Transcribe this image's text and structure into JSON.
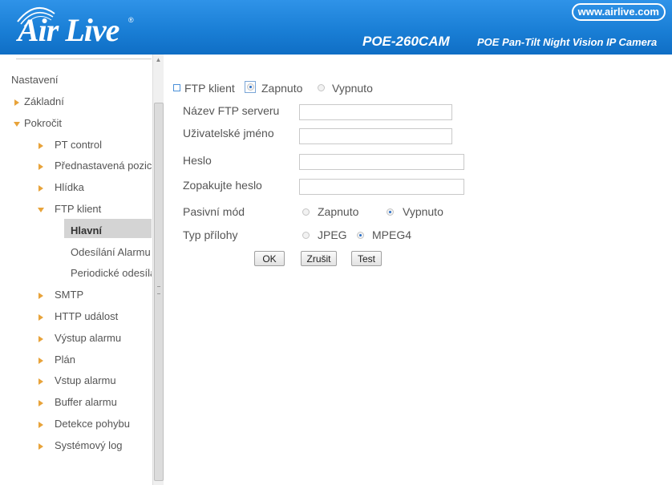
{
  "header": {
    "brand": "Air Live",
    "brand_mark": "®",
    "website": "www.airlive.com",
    "model": "POE-260CAM",
    "model_description": "POE Pan-Tilt Night Vision IP Camera"
  },
  "sidebar": {
    "root": "Nastavení",
    "items": [
      {
        "label": "Základní",
        "level": 1,
        "arrow": "right"
      },
      {
        "label": "Pokročit",
        "level": 1,
        "arrow": "down"
      },
      {
        "label": "PT control",
        "level": 2,
        "arrow": "right"
      },
      {
        "label": "Přednastavená pozice",
        "level": 2,
        "arrow": "right"
      },
      {
        "label": "Hlídka",
        "level": 2,
        "arrow": "right"
      },
      {
        "label": "FTP klient",
        "level": 2,
        "arrow": "down"
      },
      {
        "label": "Hlavní",
        "level": 3,
        "selected": true
      },
      {
        "label": "Odesílání Alarmu",
        "level": 3
      },
      {
        "label": "Periodické odesílání",
        "level": 3
      },
      {
        "label": "SMTP",
        "level": 2,
        "arrow": "right"
      },
      {
        "label": "HTTP událost",
        "level": 2,
        "arrow": "right"
      },
      {
        "label": "Výstup alarmu",
        "level": 2,
        "arrow": "right"
      },
      {
        "label": "Plán",
        "level": 2,
        "arrow": "right"
      },
      {
        "label": "Vstup alarmu",
        "level": 2,
        "arrow": "right"
      },
      {
        "label": "Buffer alarmu",
        "level": 2,
        "arrow": "right"
      },
      {
        "label": "Detekce pohybu",
        "level": 2,
        "arrow": "right"
      },
      {
        "label": "Systémový log",
        "level": 2,
        "arrow": "right"
      }
    ]
  },
  "form": {
    "ftp_client": {
      "label": "FTP klient",
      "on": "Zapnuto",
      "off": "Vypnuto",
      "value": "on"
    },
    "server_name": {
      "label": "Název FTP serveru",
      "value": ""
    },
    "username": {
      "label": "Uživatelské jméno",
      "value": ""
    },
    "password": {
      "label": "Heslo",
      "value": ""
    },
    "password_repeat": {
      "label": "Zopakujte heslo",
      "value": ""
    },
    "passive_mode": {
      "label": "Pasivní mód",
      "on": "Zapnuto",
      "off": "Vypnuto",
      "value": "off"
    },
    "attachment_type": {
      "label": "Typ přílohy",
      "opt1": "JPEG",
      "opt2": "MPEG4",
      "value": "MPEG4"
    },
    "buttons": {
      "ok": "OK",
      "cancel": "Zrušit",
      "test": "Test"
    }
  },
  "colors": {
    "header_blue": "#1a7fd6",
    "arrow_orange": "#e8a33a",
    "selected_bg": "#d4d4d4",
    "radio_dot": "#2a6fc9"
  }
}
